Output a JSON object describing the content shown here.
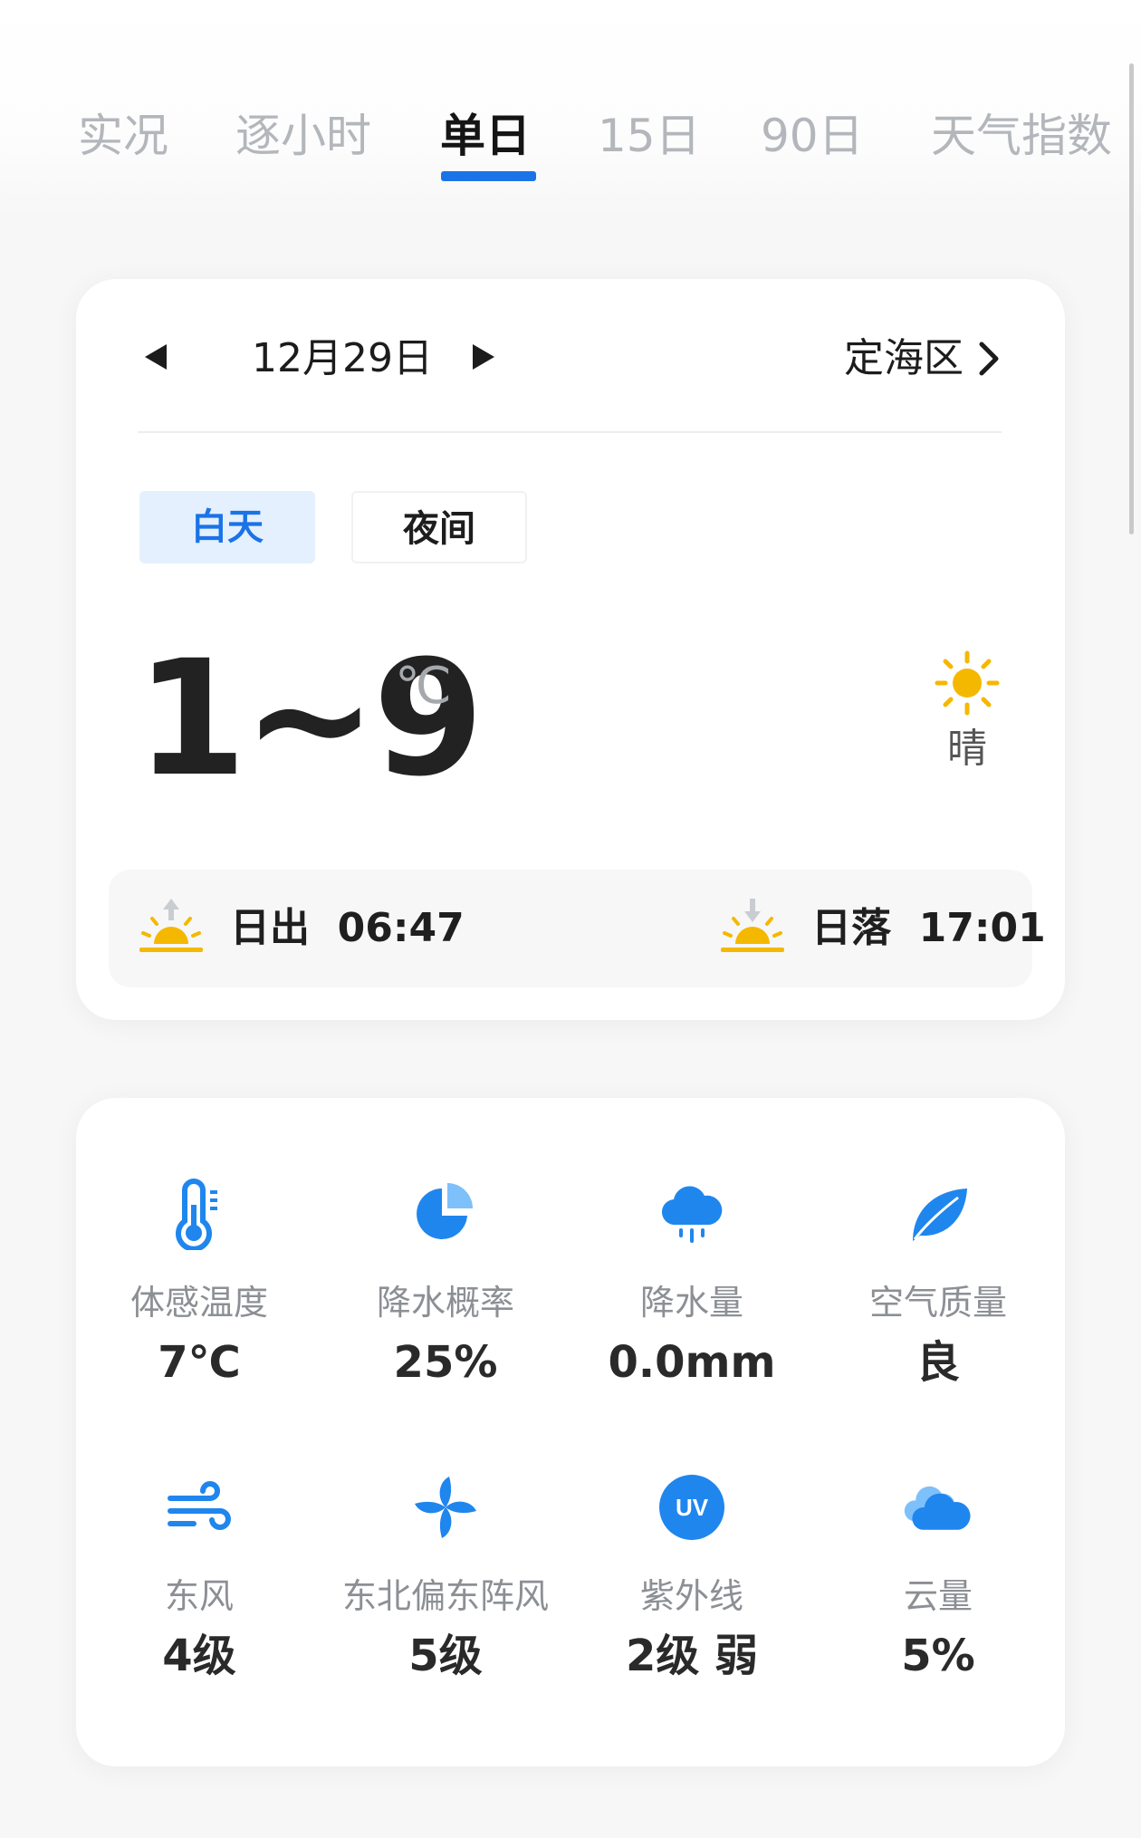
{
  "tabs": [
    "实况",
    "逐小时",
    "单日",
    "15日",
    "90日",
    "天气指数"
  ],
  "active_tab": "单日",
  "date": "12月29日",
  "location": "定海区",
  "segments": {
    "day": "白天",
    "night": "夜间"
  },
  "temperature": {
    "range": "1~9",
    "unit": "℃"
  },
  "condition": "晴",
  "sunrise": {
    "label": "日出",
    "time": "06:47"
  },
  "sunset": {
    "label": "日落",
    "time": "17:01"
  },
  "details": [
    {
      "icon": "thermometer-icon",
      "label": "体感温度",
      "value": "7℃"
    },
    {
      "icon": "pie-chart-icon",
      "label": "降水概率",
      "value": "25%"
    },
    {
      "icon": "rain-cloud-icon",
      "label": "降水量",
      "value": "0.0mm"
    },
    {
      "icon": "leaf-icon",
      "label": "空气质量",
      "value": "良"
    },
    {
      "icon": "wind-icon",
      "label": "东风",
      "value": "4级"
    },
    {
      "icon": "pinwheel-icon",
      "label": "东北偏东阵风",
      "value": "5级"
    },
    {
      "icon": "uv-icon",
      "label": "紫外线",
      "value": "2级 弱"
    },
    {
      "icon": "cloud-icon",
      "label": "云量",
      "value": "5%"
    }
  ],
  "colors": {
    "accent": "#1a74e8",
    "icon_blue": "#1f86ee",
    "sun": "#f5b800"
  }
}
